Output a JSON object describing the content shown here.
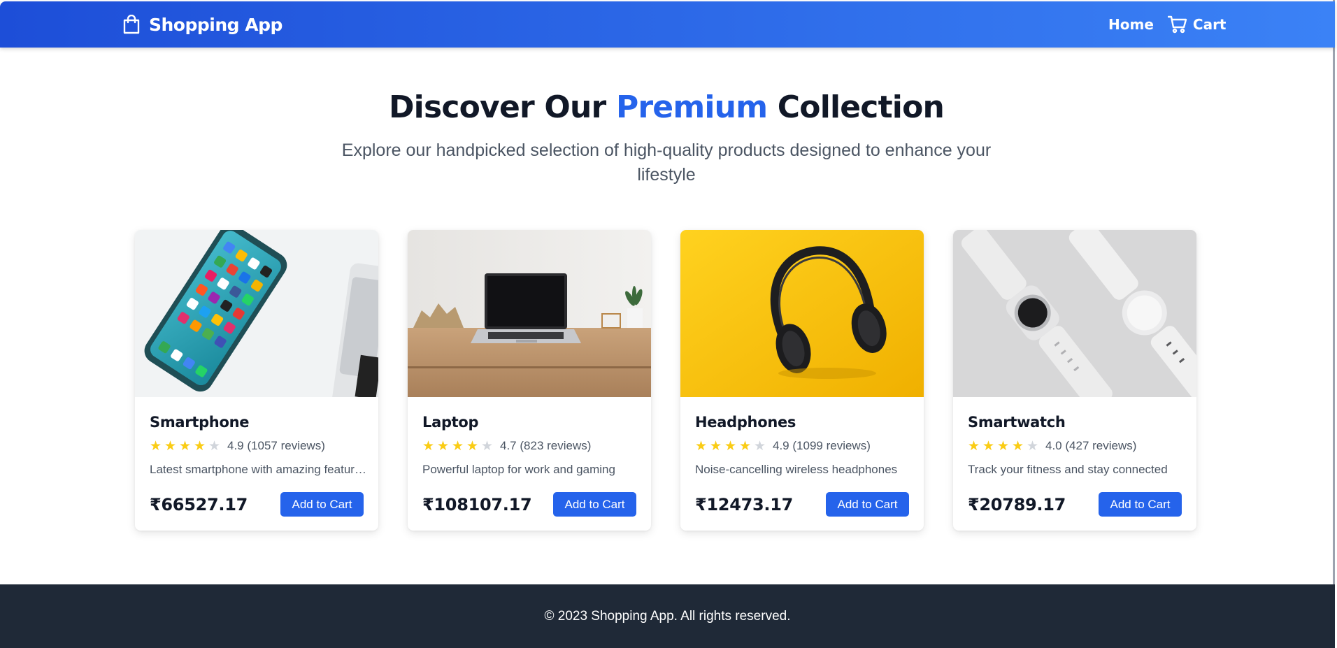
{
  "navbar": {
    "brand": "Shopping App",
    "brand_icon": "shopping-bag-icon",
    "home_label": "Home",
    "cart_label": "Cart",
    "cart_icon": "shopping-cart-icon"
  },
  "hero": {
    "title_before": "Discover Our ",
    "title_accent": "Premium",
    "title_after": " Collection",
    "subtitle": "Explore our handpicked selection of high-quality products designed to enhance your lifestyle"
  },
  "products": [
    {
      "name": "Smartphone",
      "rating": "4.9",
      "stars_filled": 4,
      "reviews": "(1057 reviews)",
      "description": "Latest smartphone with amazing features",
      "price": "₹66527.17",
      "button": "Add to Cart",
      "image": "smartphone-photo"
    },
    {
      "name": "Laptop",
      "rating": "4.7",
      "stars_filled": 4,
      "reviews": "(823 reviews)",
      "description": "Powerful laptop for work and gaming",
      "price": "₹108107.17",
      "button": "Add to Cart",
      "image": "laptop-photo"
    },
    {
      "name": "Headphones",
      "rating": "4.9",
      "stars_filled": 4,
      "reviews": "(1099 reviews)",
      "description": "Noise-cancelling wireless headphones",
      "price": "₹12473.17",
      "button": "Add to Cart",
      "image": "headphones-photo"
    },
    {
      "name": "Smartwatch",
      "rating": "4.0",
      "stars_filled": 4,
      "reviews": "(427 reviews)",
      "description": "Track your fitness and stay connected",
      "price": "₹20789.17",
      "button": "Add to Cart",
      "image": "smartwatch-photo"
    }
  ],
  "footer": {
    "text": "© 2023 Shopping App. All rights reserved."
  },
  "colors": {
    "nav_gradient_start": "#1d4ed8",
    "nav_gradient_end": "#3b82f6",
    "accent": "#2563eb",
    "star": "#facc15",
    "star_empty": "#d1d5db",
    "footer_bg": "#1f2937"
  }
}
